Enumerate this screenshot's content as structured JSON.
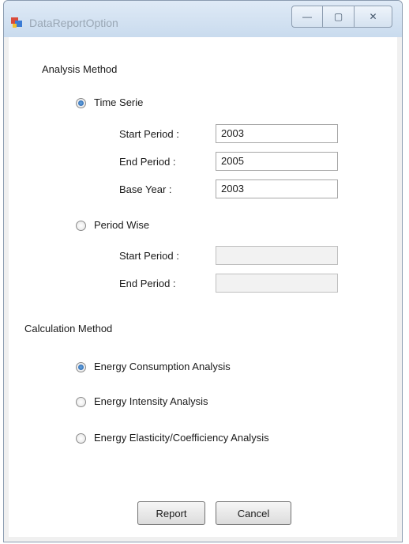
{
  "window": {
    "title": "DataReportOption",
    "controls": {
      "minimize": "—",
      "maximize": "▢",
      "close": "✕"
    }
  },
  "analysis_method": {
    "heading": "Analysis Method",
    "time_serie": {
      "label": "Time Serie",
      "selected": true,
      "start_period_label": "Start Period :",
      "start_period_value": "2003",
      "end_period_label": "End Period :",
      "end_period_value": "2005",
      "base_year_label": "Base Year :",
      "base_year_value": "2003"
    },
    "period_wise": {
      "label": "Period Wise",
      "selected": false,
      "start_period_label": "Start Period :",
      "start_period_value": "",
      "end_period_label": "End Period :",
      "end_period_value": ""
    }
  },
  "calculation_method": {
    "heading": "Calculation Method",
    "options": [
      {
        "label": "Energy Consumption Analysis",
        "selected": true
      },
      {
        "label": "Energy Intensity Analysis",
        "selected": false
      },
      {
        "label": "Energy Elasticity/Coefficiency Analysis",
        "selected": false
      }
    ]
  },
  "buttons": {
    "report": "Report",
    "cancel": "Cancel"
  }
}
